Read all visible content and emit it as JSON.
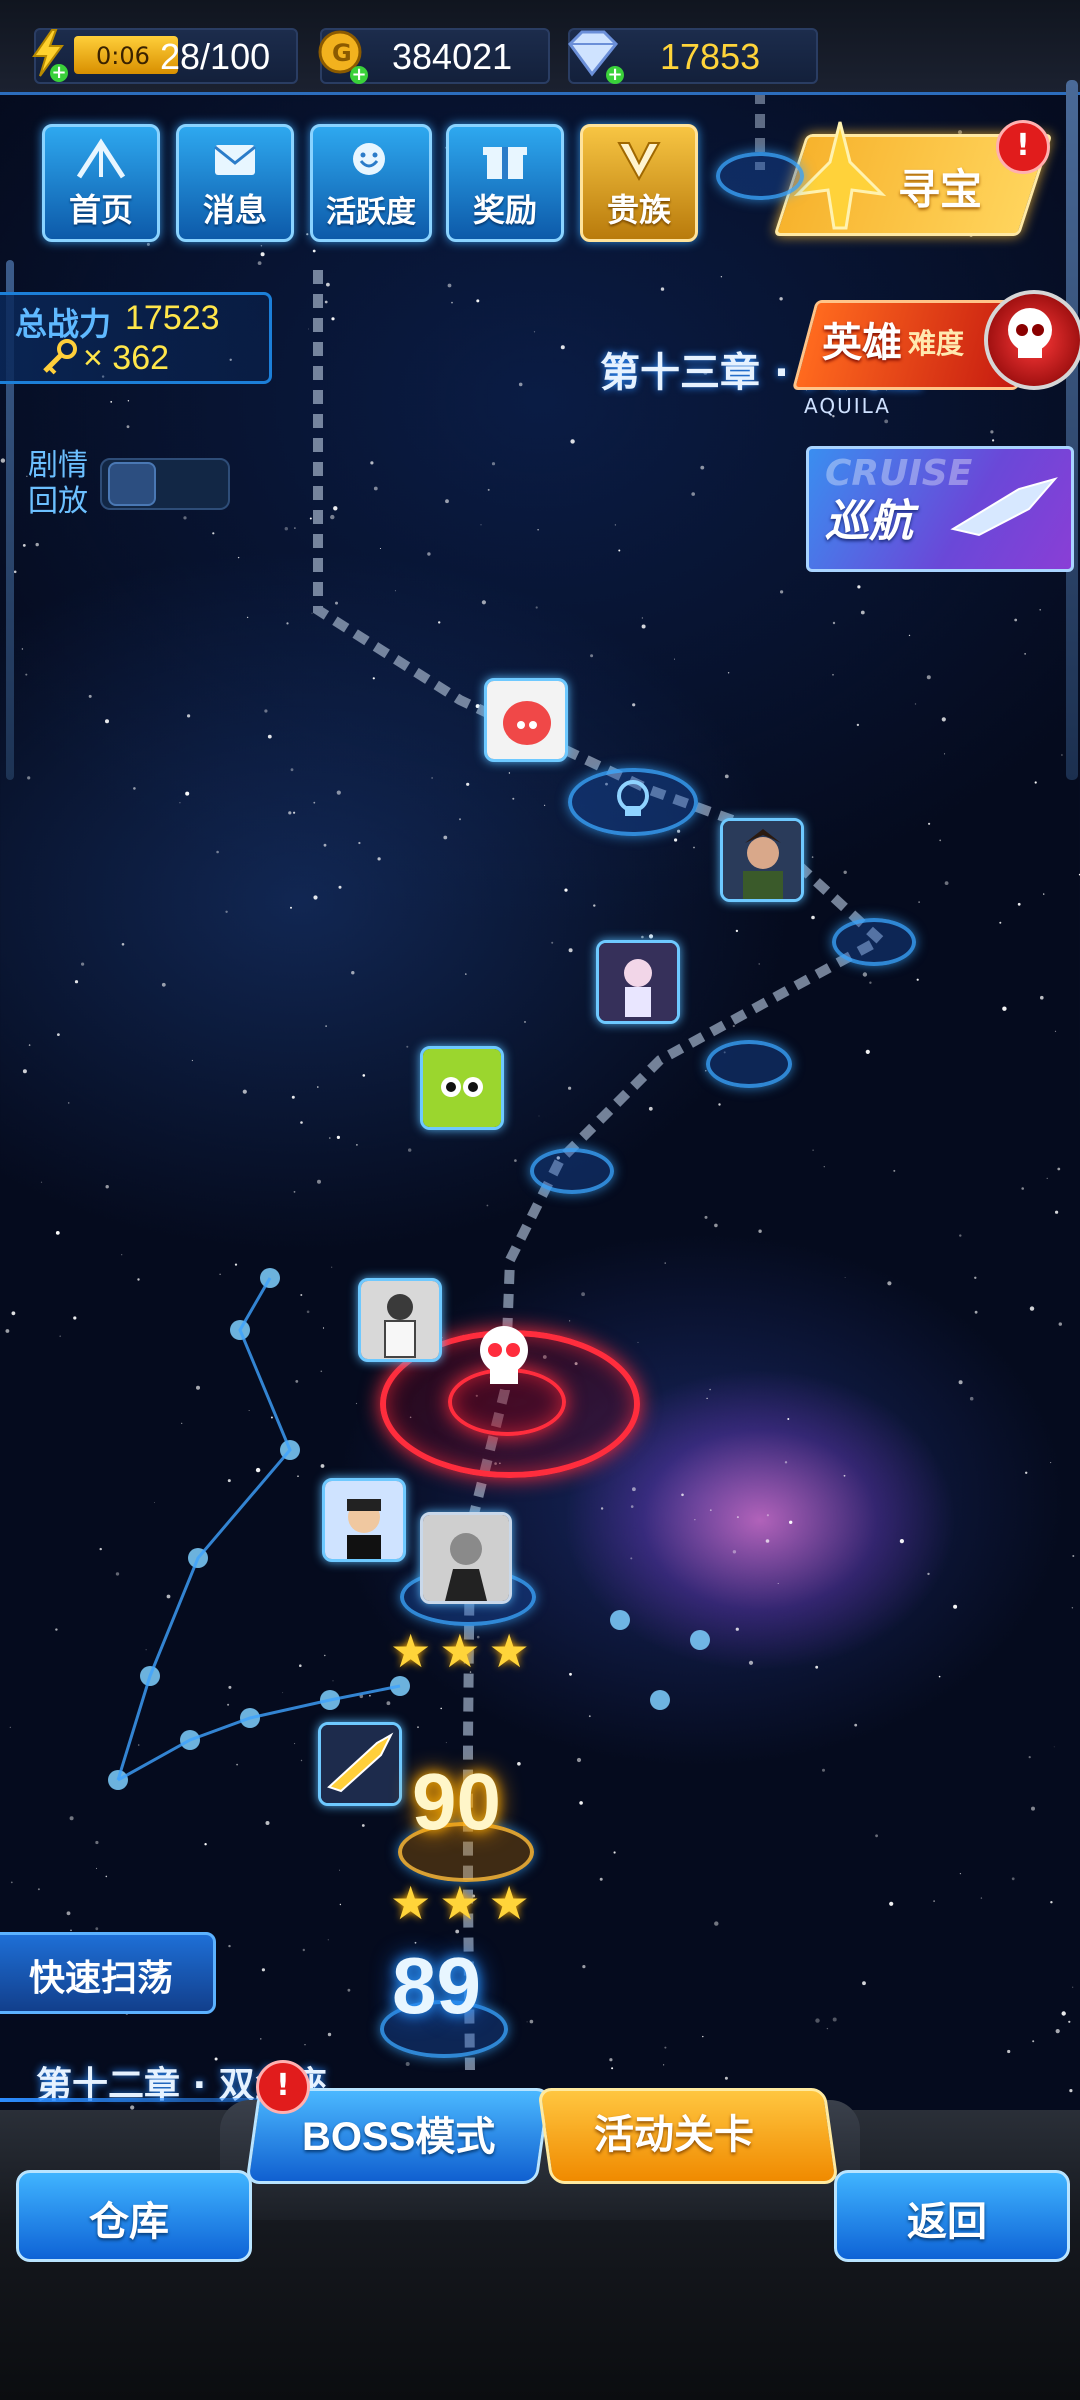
{
  "resources": {
    "energy_timer": "0:06",
    "energy": "28/100",
    "coins": "384021",
    "gems": "17853"
  },
  "menu": [
    {
      "label": "首页",
      "icon": "home-icon"
    },
    {
      "label": "消息",
      "icon": "mail-icon"
    },
    {
      "label": "活跃度",
      "icon": "smile-wings-icon"
    },
    {
      "label": "奖励",
      "icon": "gift-icon"
    },
    {
      "label": "贵族",
      "icon": "vip-icon"
    }
  ],
  "treasure": {
    "label": "寻宝",
    "badge": "!"
  },
  "player": {
    "power_label": "总战力",
    "power_value": "17523",
    "keys_value": "× 362"
  },
  "replay": {
    "line1": "剧情",
    "line2": "回放"
  },
  "hero_mode": {
    "label": "英雄",
    "sub": "难度"
  },
  "cruise": {
    "label": "巡航",
    "bg_text": "CRUISE"
  },
  "chapter_next": {
    "title": "第十三章 · 天鹰座",
    "subtitle": "AQUILA"
  },
  "levels": {
    "current": "90",
    "previous": "89"
  },
  "quick_sweep": "快速扫荡",
  "chapter_current": "第十二章 · 双鱼座",
  "buttons": {
    "boss": "BOSS模式",
    "boss_badge": "!",
    "event": "活动关卡",
    "warehouse": "仓库",
    "back": "返回"
  },
  "colors": {
    "accent_blue": "#2c8cff",
    "gold": "#ffd43a",
    "boss_red": "#ff2d3d"
  }
}
